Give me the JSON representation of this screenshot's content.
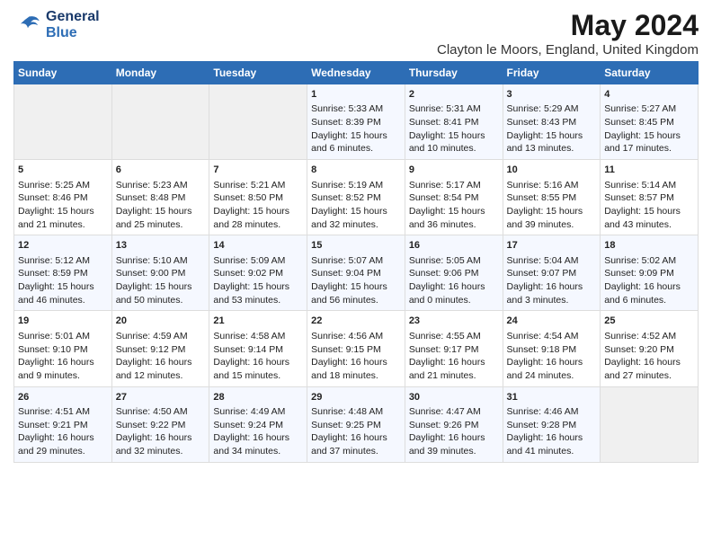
{
  "logo": {
    "line1": "General",
    "line2": "Blue"
  },
  "title": "May 2024",
  "subtitle": "Clayton le Moors, England, United Kingdom",
  "days_header": [
    "Sunday",
    "Monday",
    "Tuesday",
    "Wednesday",
    "Thursday",
    "Friday",
    "Saturday"
  ],
  "weeks": [
    [
      {
        "num": "",
        "text": ""
      },
      {
        "num": "",
        "text": ""
      },
      {
        "num": "",
        "text": ""
      },
      {
        "num": "1",
        "text": "Sunrise: 5:33 AM\nSunset: 8:39 PM\nDaylight: 15 hours\nand 6 minutes."
      },
      {
        "num": "2",
        "text": "Sunrise: 5:31 AM\nSunset: 8:41 PM\nDaylight: 15 hours\nand 10 minutes."
      },
      {
        "num": "3",
        "text": "Sunrise: 5:29 AM\nSunset: 8:43 PM\nDaylight: 15 hours\nand 13 minutes."
      },
      {
        "num": "4",
        "text": "Sunrise: 5:27 AM\nSunset: 8:45 PM\nDaylight: 15 hours\nand 17 minutes."
      }
    ],
    [
      {
        "num": "5",
        "text": "Sunrise: 5:25 AM\nSunset: 8:46 PM\nDaylight: 15 hours\nand 21 minutes."
      },
      {
        "num": "6",
        "text": "Sunrise: 5:23 AM\nSunset: 8:48 PM\nDaylight: 15 hours\nand 25 minutes."
      },
      {
        "num": "7",
        "text": "Sunrise: 5:21 AM\nSunset: 8:50 PM\nDaylight: 15 hours\nand 28 minutes."
      },
      {
        "num": "8",
        "text": "Sunrise: 5:19 AM\nSunset: 8:52 PM\nDaylight: 15 hours\nand 32 minutes."
      },
      {
        "num": "9",
        "text": "Sunrise: 5:17 AM\nSunset: 8:54 PM\nDaylight: 15 hours\nand 36 minutes."
      },
      {
        "num": "10",
        "text": "Sunrise: 5:16 AM\nSunset: 8:55 PM\nDaylight: 15 hours\nand 39 minutes."
      },
      {
        "num": "11",
        "text": "Sunrise: 5:14 AM\nSunset: 8:57 PM\nDaylight: 15 hours\nand 43 minutes."
      }
    ],
    [
      {
        "num": "12",
        "text": "Sunrise: 5:12 AM\nSunset: 8:59 PM\nDaylight: 15 hours\nand 46 minutes."
      },
      {
        "num": "13",
        "text": "Sunrise: 5:10 AM\nSunset: 9:00 PM\nDaylight: 15 hours\nand 50 minutes."
      },
      {
        "num": "14",
        "text": "Sunrise: 5:09 AM\nSunset: 9:02 PM\nDaylight: 15 hours\nand 53 minutes."
      },
      {
        "num": "15",
        "text": "Sunrise: 5:07 AM\nSunset: 9:04 PM\nDaylight: 15 hours\nand 56 minutes."
      },
      {
        "num": "16",
        "text": "Sunrise: 5:05 AM\nSunset: 9:06 PM\nDaylight: 16 hours\nand 0 minutes."
      },
      {
        "num": "17",
        "text": "Sunrise: 5:04 AM\nSunset: 9:07 PM\nDaylight: 16 hours\nand 3 minutes."
      },
      {
        "num": "18",
        "text": "Sunrise: 5:02 AM\nSunset: 9:09 PM\nDaylight: 16 hours\nand 6 minutes."
      }
    ],
    [
      {
        "num": "19",
        "text": "Sunrise: 5:01 AM\nSunset: 9:10 PM\nDaylight: 16 hours\nand 9 minutes."
      },
      {
        "num": "20",
        "text": "Sunrise: 4:59 AM\nSunset: 9:12 PM\nDaylight: 16 hours\nand 12 minutes."
      },
      {
        "num": "21",
        "text": "Sunrise: 4:58 AM\nSunset: 9:14 PM\nDaylight: 16 hours\nand 15 minutes."
      },
      {
        "num": "22",
        "text": "Sunrise: 4:56 AM\nSunset: 9:15 PM\nDaylight: 16 hours\nand 18 minutes."
      },
      {
        "num": "23",
        "text": "Sunrise: 4:55 AM\nSunset: 9:17 PM\nDaylight: 16 hours\nand 21 minutes."
      },
      {
        "num": "24",
        "text": "Sunrise: 4:54 AM\nSunset: 9:18 PM\nDaylight: 16 hours\nand 24 minutes."
      },
      {
        "num": "25",
        "text": "Sunrise: 4:52 AM\nSunset: 9:20 PM\nDaylight: 16 hours\nand 27 minutes."
      }
    ],
    [
      {
        "num": "26",
        "text": "Sunrise: 4:51 AM\nSunset: 9:21 PM\nDaylight: 16 hours\nand 29 minutes."
      },
      {
        "num": "27",
        "text": "Sunrise: 4:50 AM\nSunset: 9:22 PM\nDaylight: 16 hours\nand 32 minutes."
      },
      {
        "num": "28",
        "text": "Sunrise: 4:49 AM\nSunset: 9:24 PM\nDaylight: 16 hours\nand 34 minutes."
      },
      {
        "num": "29",
        "text": "Sunrise: 4:48 AM\nSunset: 9:25 PM\nDaylight: 16 hours\nand 37 minutes."
      },
      {
        "num": "30",
        "text": "Sunrise: 4:47 AM\nSunset: 9:26 PM\nDaylight: 16 hours\nand 39 minutes."
      },
      {
        "num": "31",
        "text": "Sunrise: 4:46 AM\nSunset: 9:28 PM\nDaylight: 16 hours\nand 41 minutes."
      },
      {
        "num": "",
        "text": ""
      }
    ]
  ]
}
